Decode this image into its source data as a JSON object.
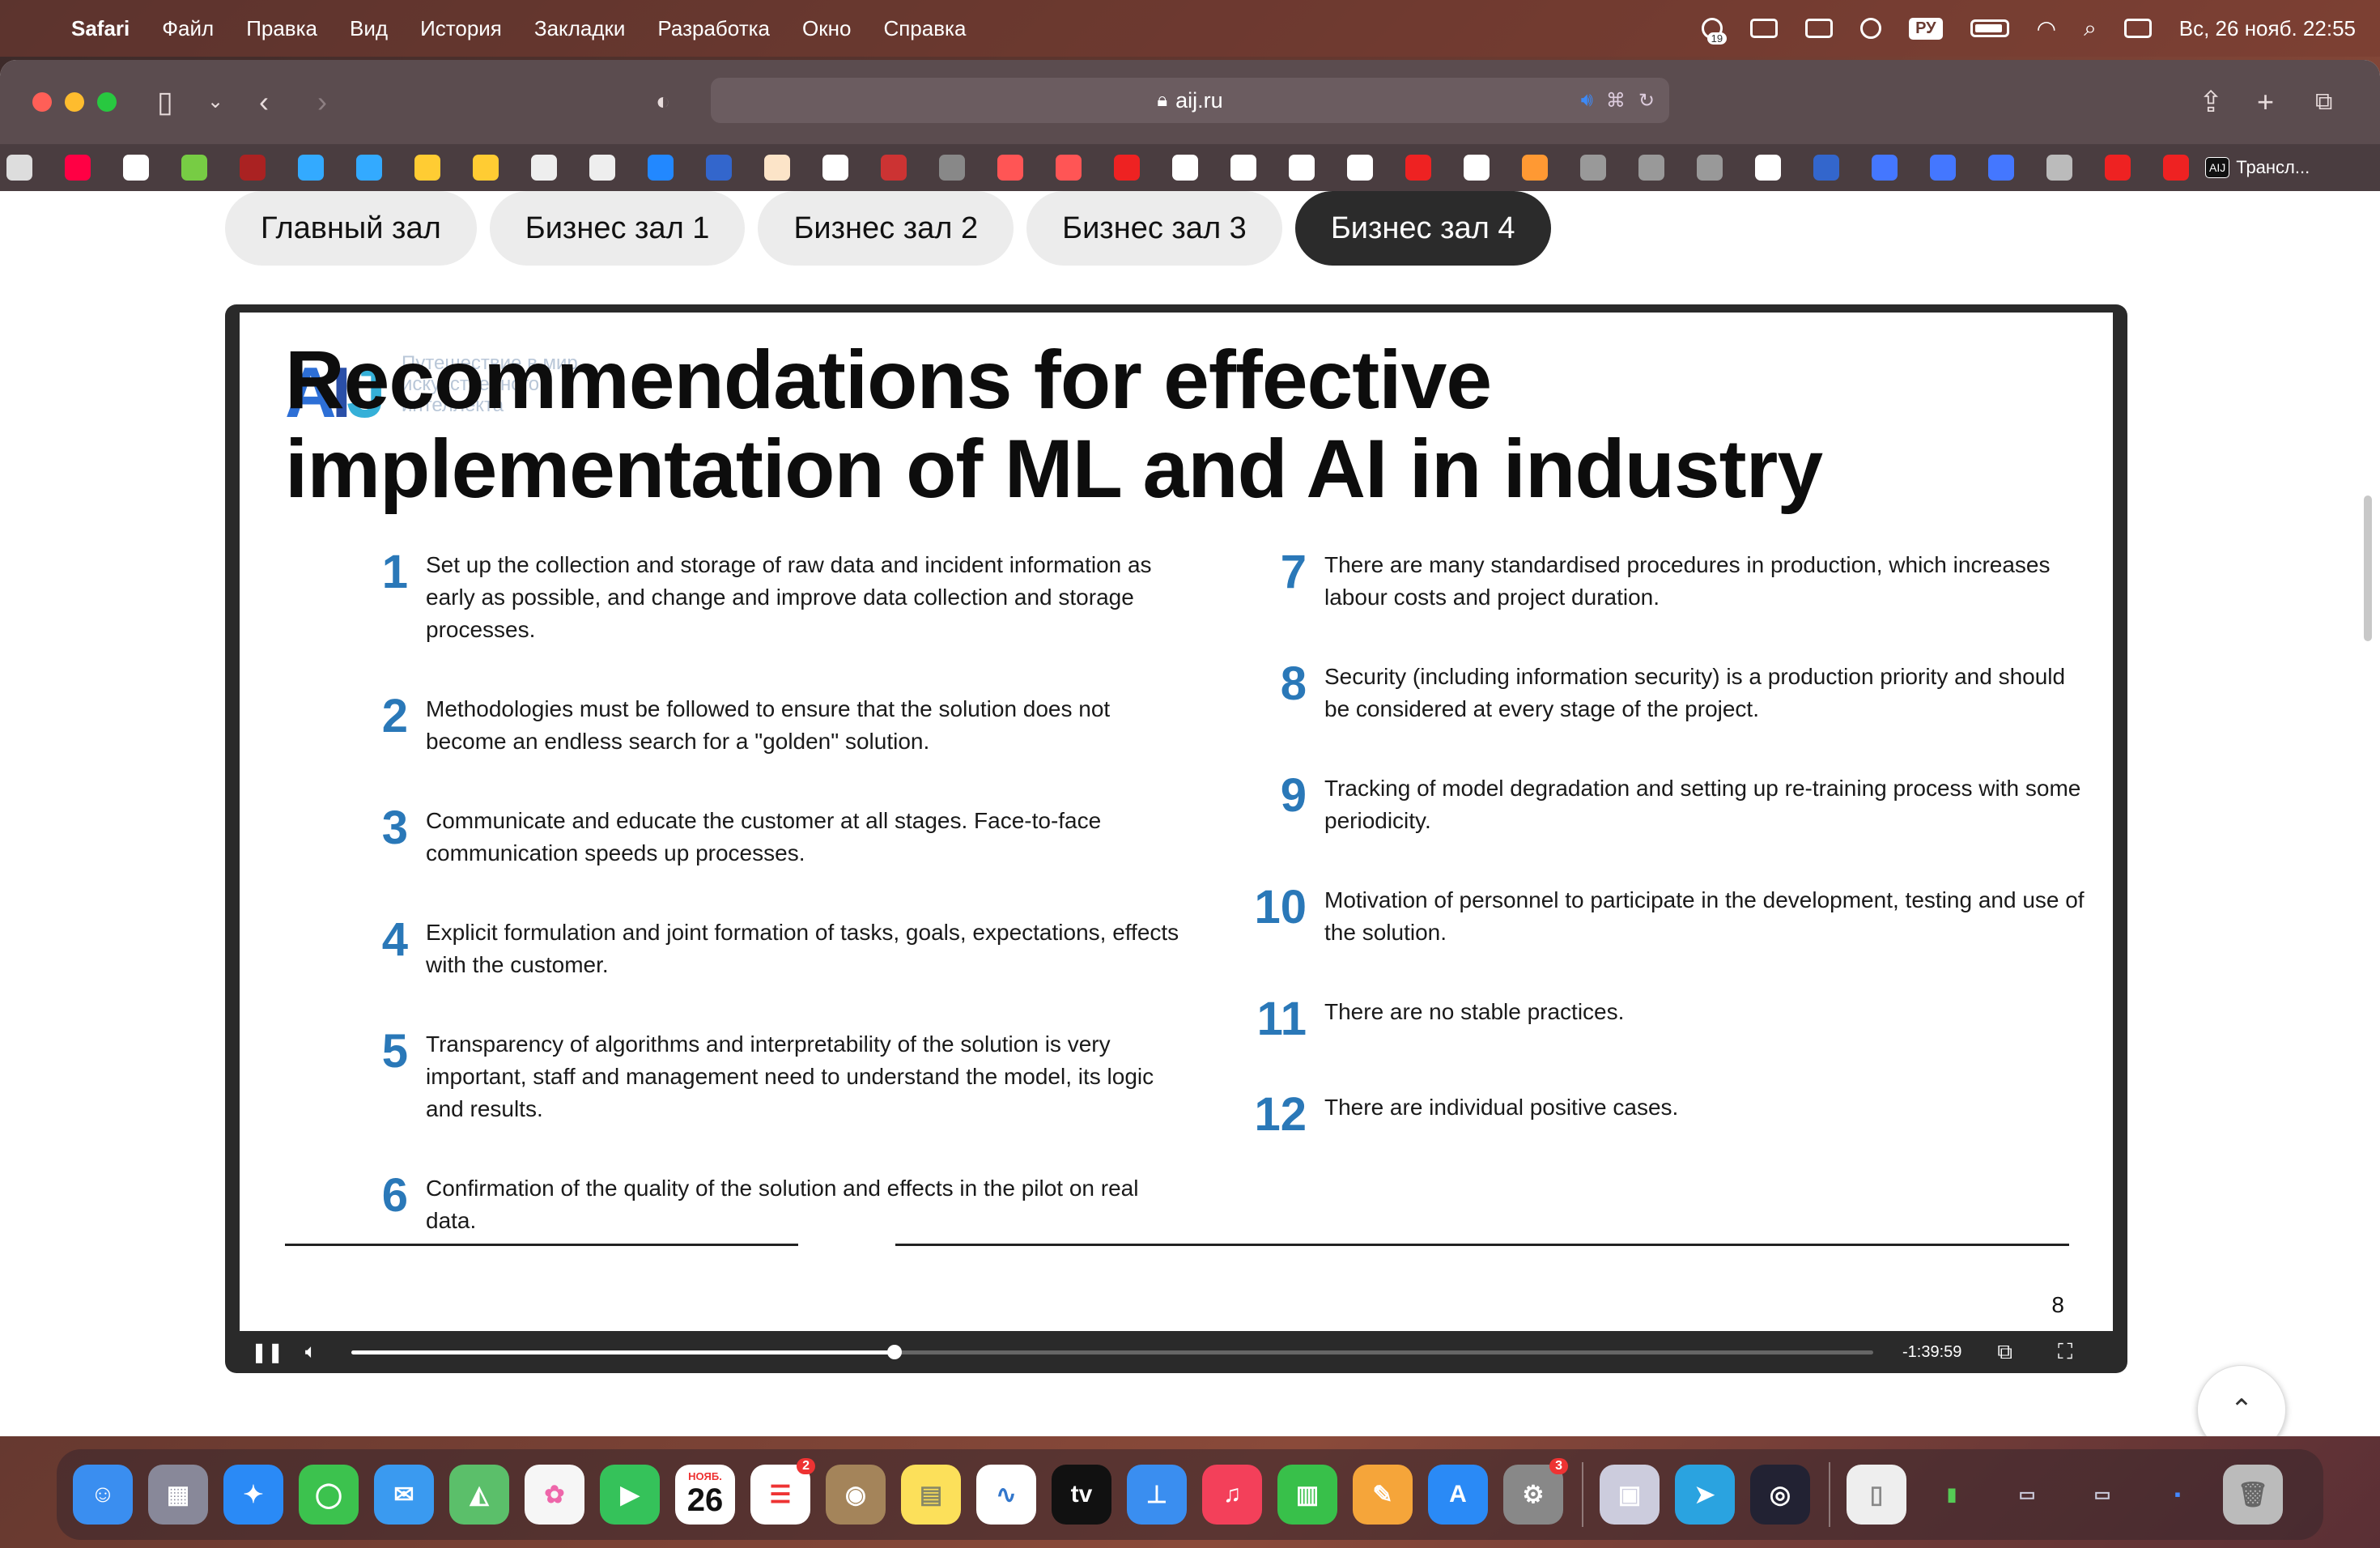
{
  "menubar": {
    "items": [
      "Safari",
      "Файл",
      "Правка",
      "Вид",
      "История",
      "Закладки",
      "Разработка",
      "Окно",
      "Справка"
    ],
    "status_badge": "19",
    "input_lang": "РУ",
    "datetime": "Вс, 26 нояб. 22:55"
  },
  "browser": {
    "url": "aij.ru",
    "bookmark_label": "Трансл..."
  },
  "hall_tabs": [
    "Главный зал",
    "Бизнес зал 1",
    "Бизнес зал 2",
    "Бизнес зал 3",
    "Бизнес зал 4"
  ],
  "active_hall": "Бизнес зал 4",
  "slide": {
    "logo": {
      "a": "A",
      "i": "I",
      "j": "J"
    },
    "logo_sub": "Путешествие в мир искусственного интеллекта",
    "title": "Recommendations for effective implementation of ML and AI in industry",
    "left_items": [
      {
        "num": "1",
        "text": "Set up the collection and storage of raw data and incident information as early as possible, and change and improve data collection and storage processes."
      },
      {
        "num": "2",
        "text": "Methodologies must be followed to ensure that the solution does not become an endless search for a \"golden\" solution."
      },
      {
        "num": "3",
        "text": "Communicate and educate the customer at all stages. Face-to-face communication speeds up processes."
      },
      {
        "num": "4",
        "text": "Explicit formulation and joint formation of tasks, goals, expectations, effects with the customer."
      },
      {
        "num": "5",
        "text": "Transparency of algorithms and interpretability of the solution is very important, staff and management need to understand the model, its logic and results."
      },
      {
        "num": "6",
        "text": "Confirmation of the quality of the solution and effects in the pilot on real data."
      }
    ],
    "right_items": [
      {
        "num": "7",
        "text": "There are many standardised procedures in production, which increases labour costs and project duration."
      },
      {
        "num": "8",
        "text": "Security (including information security) is a production priority and should be considered at every stage of the project."
      },
      {
        "num": "9",
        "text": "Tracking of model degradation and setting up re-training process with some periodicity."
      },
      {
        "num": "10",
        "text": "Motivation of personnel to participate in the development, testing and use of the solution."
      },
      {
        "num": "11",
        "text": "There are no stable practices."
      },
      {
        "num": "12",
        "text": "There are individual positive cases."
      }
    ],
    "page_number": "8"
  },
  "player": {
    "time_remaining": "-1:39:59",
    "progress": 0.357
  },
  "dock": {
    "calendar_month": "НОЯБ.",
    "calendar_day": "26",
    "reminders_badge": "2",
    "settings_badge": "3"
  },
  "colors": {
    "accent_number": "#2a78b8",
    "active_tab_bg": "#2b2b2b"
  }
}
